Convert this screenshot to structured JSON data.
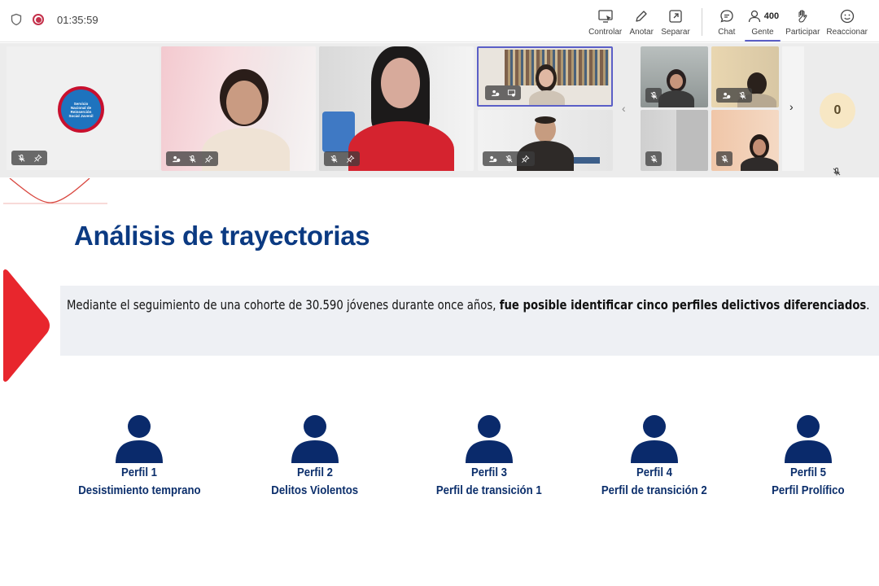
{
  "toolbar": {
    "timer": "01:35:59",
    "buttons": {
      "controlar": "Controlar",
      "anotar": "Anotar",
      "separar": "Separar",
      "chat": "Chat",
      "gente": "Gente",
      "gente_count": "400",
      "participar": "Participar",
      "reaccionar": "Reaccionar"
    },
    "accent_color": "#5b5fc7"
  },
  "logo": {
    "lines": [
      "Servicio",
      "Nacional de",
      "Reinserción",
      "Social Juvenil"
    ]
  },
  "strip": {
    "hidden_count": "0"
  },
  "slide": {
    "title": "Análisis de trayectorias",
    "quote_regular": "Mediante el seguimiento de una cohorte de 30.590 jóvenes durante once años, ",
    "quote_bold": "fue posible identificar cinco perfiles delictivos diferenciados",
    "quote_end": ".",
    "profiles": [
      {
        "name": "Perfil 1",
        "desc": "Desistimiento temprano"
      },
      {
        "name": "Perfil 2",
        "desc": "Delitos Violentos"
      },
      {
        "name": "Perfil 3",
        "desc": "Perfil de transición 1"
      },
      {
        "name": "Perfil 4",
        "desc": "Perfil de transición 2"
      },
      {
        "name": "Perfil 5",
        "desc": "Perfil Prolífico"
      }
    ],
    "colors": {
      "title": "#0b3a82",
      "profile": "#0b2e6b",
      "arrow": "#e8262d"
    }
  }
}
